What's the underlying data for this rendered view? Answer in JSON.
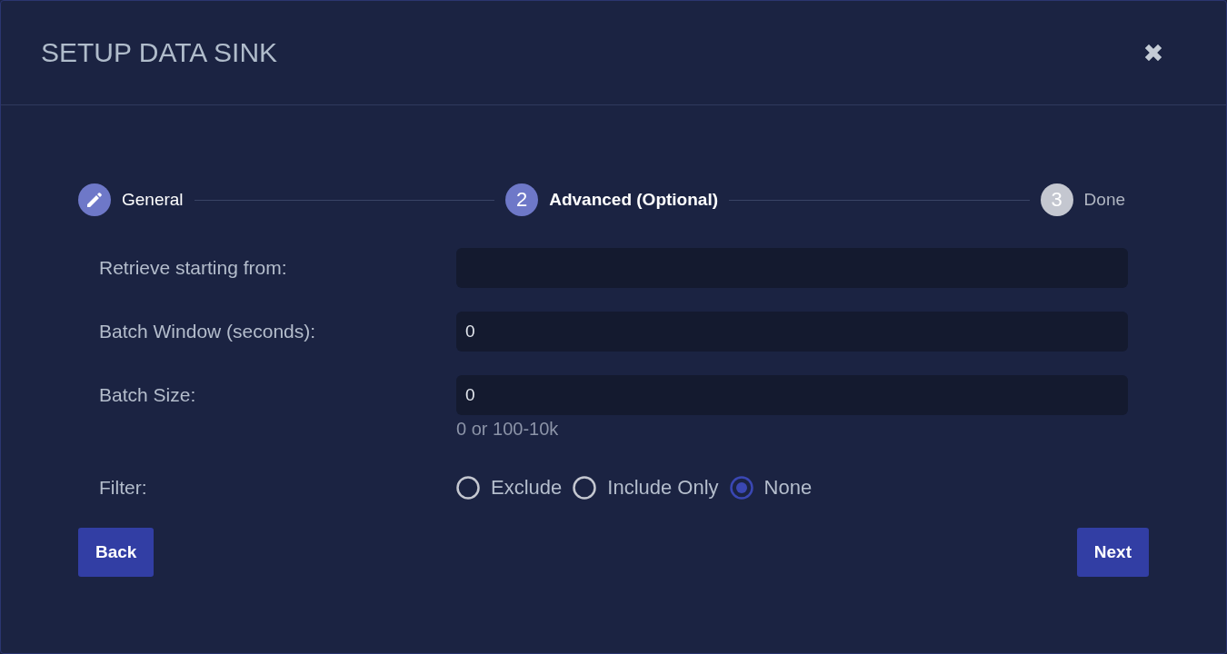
{
  "dialog": {
    "title": "SETUP DATA SINK"
  },
  "steps": [
    {
      "kind": "icon",
      "selected": false,
      "label": "General"
    },
    {
      "kind": "number",
      "selected": true,
      "number": "2",
      "label": "Advanced (Optional)"
    },
    {
      "kind": "number",
      "selected": false,
      "number": "3",
      "label": "Done"
    }
  ],
  "fields": [
    {
      "label": "Retrieve starting from:"
    },
    {
      "label": "Batch Window (seconds):",
      "value": "0"
    },
    {
      "label": "Batch Size:",
      "value": "0",
      "hint": "0 or 100-10k"
    }
  ],
  "filter": {
    "label": "Filter:",
    "options": [
      {
        "label": "Exclude",
        "selected": false
      },
      {
        "label": "Include Only",
        "selected": false
      },
      {
        "label": "None",
        "selected": true
      }
    ]
  },
  "buttons": {
    "back": "Back",
    "next": "Next"
  }
}
